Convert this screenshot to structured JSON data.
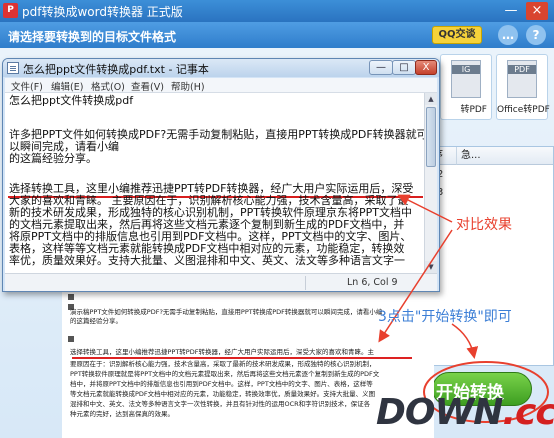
{
  "app": {
    "title": "pdf转换成word转换器  正式版",
    "logo": "P",
    "instruction": "请选择要转换到的目标文件格式",
    "qq_label": "QQ交谈",
    "chat_icon": "…",
    "help_icon": "?",
    "minimize": "—",
    "close": "×",
    "tiles": [
      {
        "caption": "转PDF",
        "tag": "IG"
      },
      {
        "caption": "Office转PDF",
        "tag": "PDF"
      }
    ],
    "list_columns": [
      "序",
      "急..."
    ],
    "list_rows": [
      "2",
      "3"
    ],
    "start_label": "开始转换"
  },
  "notepad": {
    "title": "怎么把ppt文件转换成pdf.txt - 记事本",
    "controls": {
      "min": "—",
      "max": "□",
      "close": "X"
    },
    "menus": [
      "文件(F)",
      "编辑(E)",
      "格式(O)",
      "查看(V)",
      "帮助(H)"
    ],
    "lines": [
      "      怎么把ppt文件转换成pdf",
      "",
      "",
      "许多把PPT文件如何转换成PDF?无需手动复制粘贴，直接用PPT转换成PDF转换器就可",
      "以瞬间完成，请看小编",
      "的这篇经验分享。",
      "",
      "",
      "选择转换工具，这里小编推荐迅捷PPT转PDF转换器，经广大用户实际运用后，深受",
      "大家的喜欢和青睐。   主要原因在于，识别解析核心能力强，技术含量高，采取了最",
      "新的技术研发成果，形成独特的核心识别机制，PPT转换软件原理京东将PPT文档中",
      "的文档元素提取出来，然后再将这些文档元素逐个复制到新生成的PDF文档中，并",
      "将原PPT文档中的排版信息也引用到PDF文档中。这样，PPT文档中的文字、图片、",
      "表格，这样等等文档元素就能转换成PDF文档中相对应的元素，功能稳定，转换效",
      "率优，质量效果好。支持大批量、义图混排和中文、英文、法文等多种语言文字一"
    ],
    "status": "Ln 6, Col 9"
  },
  "doc_preview": {
    "paragraphs": [
      "演示稿PPT文件如何转换成PDF?无需手动复制粘贴，直接用PPT转换成PDF转换器就可以瞬间完成，请看小编",
      "的这篇经验分享。",
      "选择转换工具，这里小编推荐迅捷PPT转PDF转换器，经广大用户实际运用后，深受大家的喜欢和青睐。主",
      "要原因在于：识别解析核心能力强，技术含量高，采取了最新的技术研发成果，形成独特的核心识别机制，",
      "PPT转换软件原理就是将PPT文档中的文档元素提取出来，然后再将这些文档元素逐个复制到新生成的PDF文",
      "档中，并将原PPT文档中的排版信息也引用到PDF文档中。这样，PPT文档中的文字、图片、表格，这样等",
      "等文档元素就能转换成PDF文档中相对应的元素，功能稳定，转换效率优，质量效果好。支持大批量、义图",
      "混排和中文、英文、法文等多种语言文字一次性转换，并且有针对性的运用OCR和字符识别技术，保证各",
      "种元素的完好，达到高保真的效果。"
    ]
  },
  "annotations": {
    "contrast": "对比效果",
    "click_hint": "3点击\"开始转换\"即可",
    "color_red": "#e8402e",
    "color_blue": "#3d7fd6"
  },
  "watermark": {
    "main": "DOWN",
    "tld": ".cc"
  }
}
